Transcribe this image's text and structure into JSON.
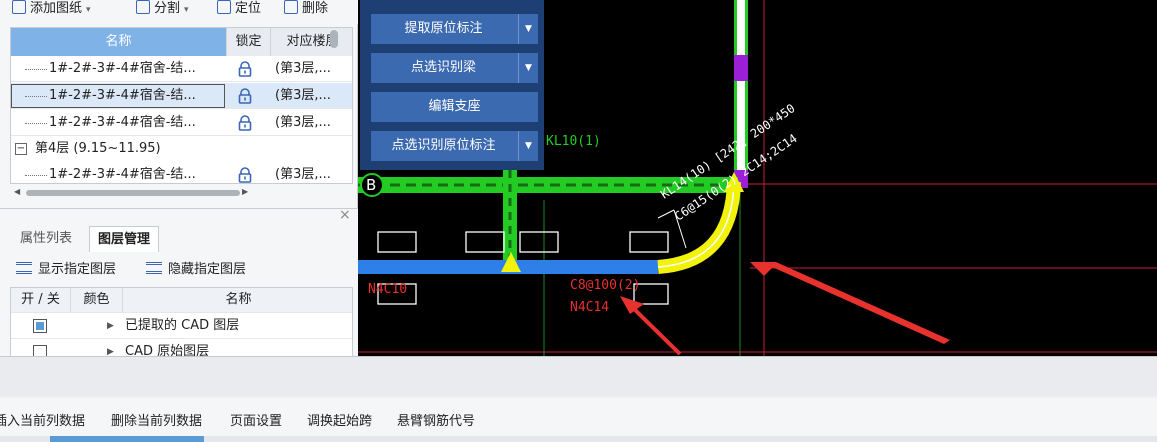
{
  "drawing_toolbar": {
    "add_drawing": "添加图纸",
    "split": "分割",
    "locate": "定位",
    "delete": "删除"
  },
  "drawing_table": {
    "headers": {
      "name": "名称",
      "lock": "锁定",
      "floor": "对应楼层"
    },
    "rows": [
      {
        "name": "1#-2#-3#-4#宿舍-结...",
        "floor": "(第3层,..."
      },
      {
        "name": "1#-2#-3#-4#宿舍-结...",
        "floor": "(第3层,..."
      },
      {
        "name": "1#-2#-3#-4#宿舍-结...",
        "floor": "(第3层,..."
      }
    ],
    "group": {
      "toggle": "−",
      "label": "第4层 (9.15~11.95)"
    },
    "group_rows": [
      {
        "name": "1#-2#-3#-4#宿舍-结...",
        "floor": "(第3层,..."
      }
    ]
  },
  "layer_panel": {
    "tabs": {
      "props": "属性列表",
      "layers": "图层管理"
    },
    "show_layers": "显示指定图层",
    "hide_layers": "隐藏指定图层",
    "headers": {
      "onoff": "开 / 关",
      "color": "颜色",
      "name": "名称"
    },
    "rows": [
      {
        "checked": true,
        "name": "已提取的 CAD 图层"
      },
      {
        "checked": false,
        "name": "CAD 原始图层"
      }
    ],
    "close": "×"
  },
  "command_menu": {
    "items": [
      {
        "label": "提取原位标注",
        "dropdown": true
      },
      {
        "label": "点选识别梁",
        "dropdown": true
      },
      {
        "label": "编辑支座",
        "dropdown": false
      },
      {
        "label": "点选识别原位标注",
        "dropdown": true
      }
    ]
  },
  "cad": {
    "axis_label": "B",
    "beam_label": "KL10(1)",
    "beam_annotation_1": "KL14(10) [242] 200*450",
    "beam_annotation_2": "C6@15(0(2) 2C14;2C14",
    "stirrup_text": "C8@100(2)",
    "bottom_bar_text": "N4C14",
    "side_bar_text": "N4C10"
  },
  "bottom_toolbar": {
    "items": [
      "插入当前列数据",
      "删除当前列数据",
      "页面设置",
      "调换起始跨",
      "悬臂钢筋代号"
    ]
  },
  "colors": {
    "menu_bg": "#1d3f74",
    "menu_button": "#3c6ab0",
    "header_accent": "#7fb3e8",
    "beam_green": "#22cc22",
    "beam_blue": "#2f7fe8",
    "beam_yellow": "#f2f20a",
    "arrow_red": "#e8322e"
  }
}
